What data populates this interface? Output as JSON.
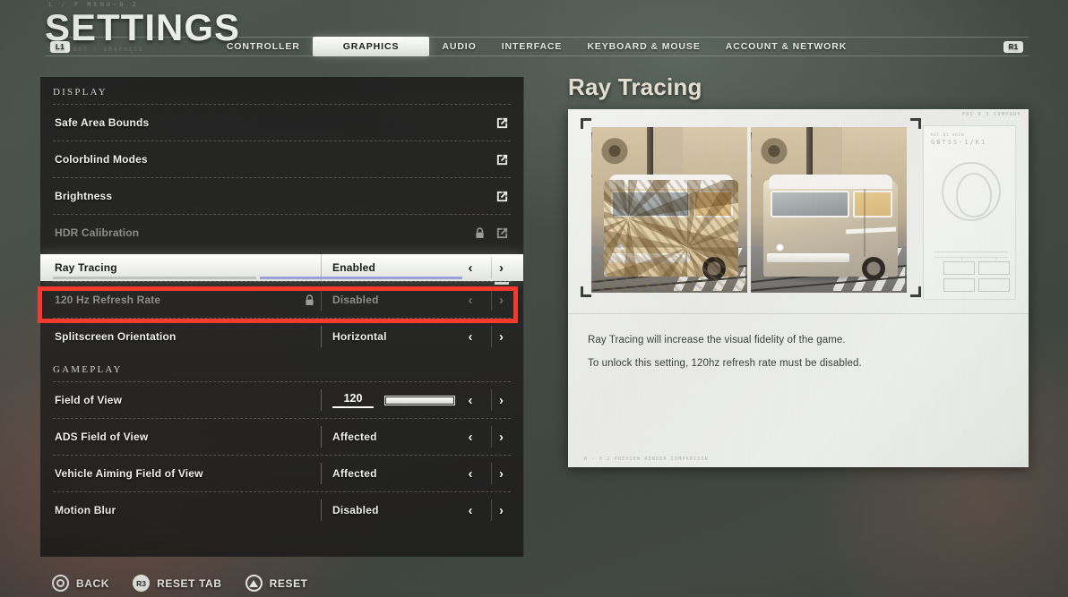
{
  "header": {
    "pretitle": "L / F  MENU-0 2",
    "title": "SETTINGS",
    "subtitle_line": "SETTINGS / GRAPHICS"
  },
  "tabs": [
    {
      "label": "L1",
      "type": "bumper",
      "active": false
    },
    {
      "label": "CONTROLLER",
      "type": "tab",
      "active": false
    },
    {
      "label": "GRAPHICS",
      "type": "tab",
      "active": true
    },
    {
      "label": "AUDIO",
      "type": "tab",
      "active": false
    },
    {
      "label": "INTERFACE",
      "type": "tab",
      "active": false
    },
    {
      "label": "KEYBOARD & MOUSE",
      "type": "tab",
      "active": false
    },
    {
      "label": "ACCOUNT & NETWORK",
      "type": "tab",
      "active": false
    },
    {
      "label": "R1",
      "type": "bumper",
      "active": false
    }
  ],
  "groups": [
    {
      "name": "DISPLAY",
      "rows": [
        {
          "label": "Safe Area Bounds",
          "kind": "link",
          "value": "",
          "locked": false,
          "selected": false
        },
        {
          "label": "Colorblind Modes",
          "kind": "link",
          "value": "",
          "locked": false,
          "selected": false
        },
        {
          "label": "Brightness",
          "kind": "link",
          "value": "",
          "locked": false,
          "selected": false
        },
        {
          "label": "HDR Calibration",
          "kind": "link",
          "value": "",
          "locked": true,
          "selected": false
        },
        {
          "label": "Ray Tracing",
          "kind": "select",
          "value": "Enabled",
          "locked": false,
          "selected": true
        },
        {
          "label": "120 Hz Refresh Rate",
          "kind": "select",
          "value": "Disabled",
          "locked": true,
          "selected": false,
          "focused": true
        },
        {
          "label": "Splitscreen Orientation",
          "kind": "select",
          "value": "Horizontal",
          "locked": false,
          "selected": false
        }
      ]
    },
    {
      "name": "GAMEPLAY",
      "rows": [
        {
          "label": "Field of View",
          "kind": "slider",
          "value": "120",
          "locked": false,
          "selected": false
        },
        {
          "label": "ADS Field of View",
          "kind": "select",
          "value": "Affected",
          "locked": false,
          "selected": false
        },
        {
          "label": "Vehicle Aiming Field of View",
          "kind": "select",
          "value": "Affected",
          "locked": false,
          "selected": false
        },
        {
          "label": "Motion Blur",
          "kind": "select",
          "value": "Disabled",
          "locked": false,
          "selected": false
        }
      ]
    }
  ],
  "detail": {
    "title": "Ray Tracing",
    "card_tiny_code": "PRV-0 3  COMPARE",
    "stamp_code_small": "REF.01  ARCH",
    "stamp_code": "GBTSS-1/K1",
    "description_lines": [
      "Ray Tracing will increase the visual fidelity of the game.",
      "To unlock this setting, 120hz refresh rate must be disabled."
    ],
    "footer_tiny": "B - 0 2    PREVIEW RENDER COMPARISON"
  },
  "footer_buttons": [
    {
      "glyph": "circle-button-icon",
      "glyph_label": "",
      "label": "BACK"
    },
    {
      "glyph": "r3-button-icon",
      "glyph_label": "R3",
      "label": "RESET TAB"
    },
    {
      "glyph": "triangle-button-icon",
      "glyph_label": "",
      "label": "RESET"
    }
  ],
  "colors": {
    "focus_highlight": "#f4392f",
    "accent_selector": "#9aa0d8",
    "panel_background": "#1e1e1d",
    "detail_title": "#e4ded0"
  }
}
